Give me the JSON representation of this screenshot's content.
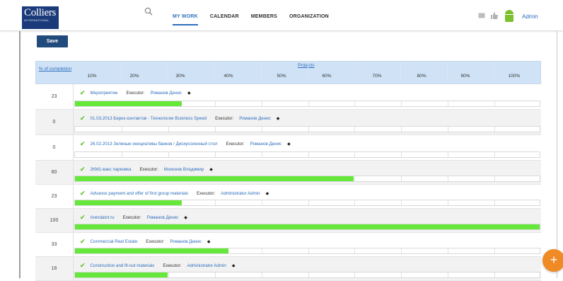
{
  "logo": {
    "line1": "Colliers",
    "line2": "INTERNATIONAL"
  },
  "nav": {
    "items": [
      "MY WORK",
      "CALENDAR",
      "MEMBERS",
      "ORGANIZATION"
    ]
  },
  "header_right": {
    "user": "Admin"
  },
  "toolbar": {
    "save_label": "Save"
  },
  "table": {
    "pct_header": "% of completion",
    "projects_header": "Projects",
    "columns": [
      "10%",
      "20%",
      "30%",
      "40%",
      "50%",
      "60%",
      "70%",
      "80%",
      "90%",
      "100%"
    ],
    "executor_label": "Executor:",
    "rows": [
      {
        "completion": "23",
        "progress": 23,
        "task": "Мероприятие",
        "executor": "Романов Денис"
      },
      {
        "completion": "0",
        "progress": 0,
        "task": "01.03.2013 Бериз контактов - Технологии Business Speed",
        "executor": "Романов Денис"
      },
      {
        "completion": "0",
        "progress": 0,
        "task": "26.02.2013 Зеленые инициативы банков / Дискуссионный стол",
        "executor": "Романов Денис"
      },
      {
        "completion": "60",
        "progress": 60,
        "task": "2КМ1-вакс парковка",
        "executor": "Моисеев Владимир"
      },
      {
        "completion": "23",
        "progress": 23,
        "task": "Advance payment and offer of first group materials",
        "executor": "Administrator Admin"
      },
      {
        "completion": "100",
        "progress": 100,
        "task": "Arendator.ru",
        "executor": "Романов Денис"
      },
      {
        "completion": "33",
        "progress": 33,
        "task": "Commercial Real Estate",
        "executor": "Романов Денис"
      },
      {
        "completion": "16",
        "progress": 20,
        "task": "Construction and fit-out materials",
        "executor": "Administrator Admin"
      }
    ]
  },
  "fab": {
    "label": "+"
  },
  "colors": {
    "accent": "#2f6fbe",
    "progress": "#66e83b",
    "brand": "#1a3a7a",
    "fab": "#f08a24"
  }
}
